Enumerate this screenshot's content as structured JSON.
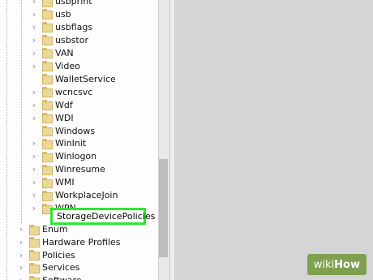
{
  "tree": {
    "child_items": [
      {
        "label": "usbprint",
        "expander": "›",
        "has_expander": true
      },
      {
        "label": "usb",
        "expander": "›",
        "has_expander": true
      },
      {
        "label": "usbflags",
        "expander": "›",
        "has_expander": true
      },
      {
        "label": "usbstor",
        "expander": "›",
        "has_expander": true
      },
      {
        "label": "VAN",
        "expander": "›",
        "has_expander": true
      },
      {
        "label": "Video",
        "expander": "›",
        "has_expander": true
      },
      {
        "label": "WalletService",
        "expander": "",
        "has_expander": false
      },
      {
        "label": "wcncsvc",
        "expander": "›",
        "has_expander": true
      },
      {
        "label": "Wdf",
        "expander": "›",
        "has_expander": true
      },
      {
        "label": "WDI",
        "expander": "›",
        "has_expander": true
      },
      {
        "label": "Windows",
        "expander": "",
        "has_expander": false
      },
      {
        "label": "WinInit",
        "expander": "›",
        "has_expander": true
      },
      {
        "label": "Winlogon",
        "expander": "›",
        "has_expander": true
      },
      {
        "label": "Winresume",
        "expander": "›",
        "has_expander": true
      },
      {
        "label": "WMI",
        "expander": "›",
        "has_expander": true
      },
      {
        "label": "WorkplaceJoin",
        "expander": "›",
        "has_expander": true
      },
      {
        "label": "WPN",
        "expander": "›",
        "has_expander": true
      }
    ],
    "editing_item": {
      "value": "StorageDevicePolicies"
    },
    "parent_items": [
      {
        "label": "Enum",
        "expander": "›"
      },
      {
        "label": "Hardware Profiles",
        "expander": "›"
      },
      {
        "label": "Policies",
        "expander": "›"
      },
      {
        "label": "Services",
        "expander": "›"
      },
      {
        "label": "Software",
        "expander": "›"
      }
    ]
  },
  "watermark": {
    "prefix": "wiki",
    "suffix": "How"
  },
  "colors": {
    "highlight": "#2fe62f",
    "folder": "#ecd79a",
    "pane_bg": "#fdfdfd",
    "right_pane": "#d5d5d5",
    "watermark_bg": "#7fa04f"
  },
  "icons": {
    "folder": "folder-icon",
    "expander": "chevron-right-icon"
  }
}
